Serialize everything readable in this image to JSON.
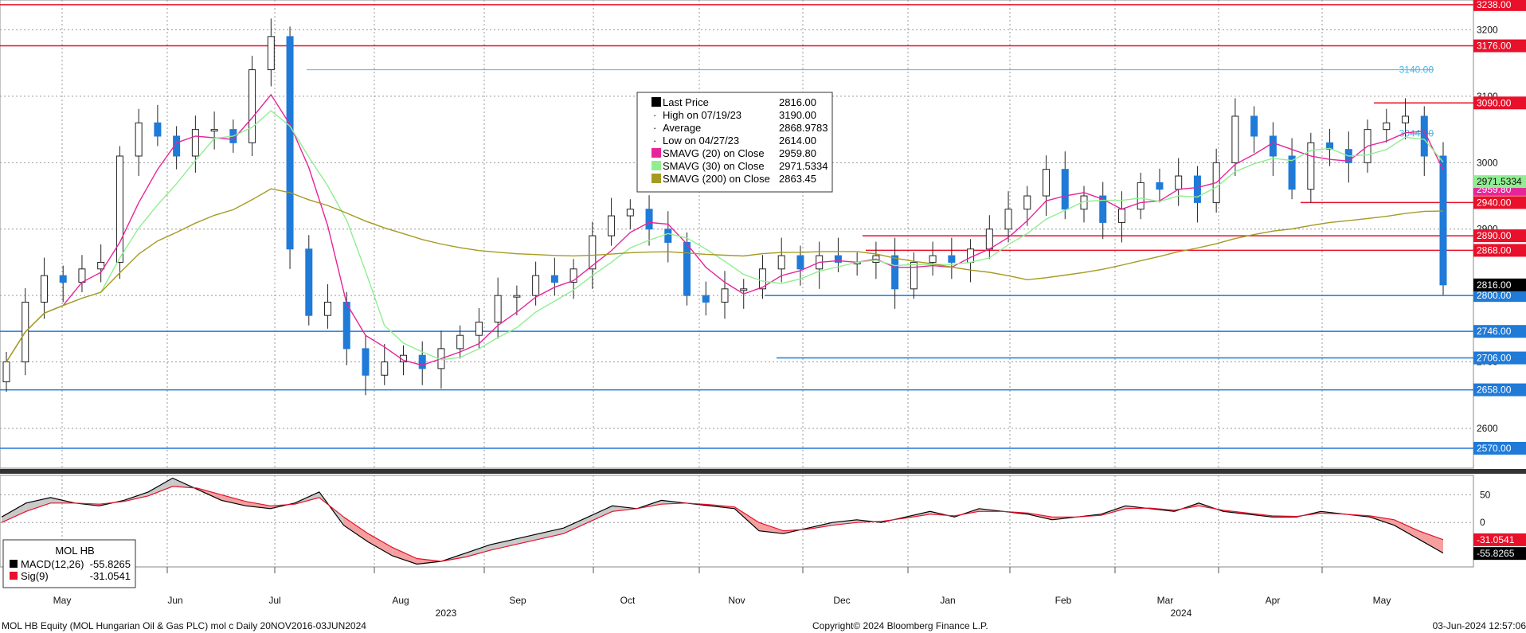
{
  "chart_data": [
    {
      "type": "candlestick",
      "title": "MOL HB Equity (MOL Hungarian Oil & Gas PLC) mol c  Daily 20NOV2016-03JUN2024",
      "x_months": [
        "May",
        "Jun",
        "Jul",
        "Aug",
        "Sep",
        "Oct",
        "Nov",
        "Dec",
        "Jan",
        "Feb",
        "Mar",
        "Apr",
        "May"
      ],
      "x_years": [
        "2023",
        "2024"
      ],
      "ylim": [
        2540,
        3245
      ],
      "y_ticks": [
        2600,
        2700,
        2800,
        2900,
        3000,
        3100,
        3200
      ],
      "grid": true,
      "candles_weekly_close": [
        2700,
        2790,
        2830,
        2820,
        2840,
        2850,
        3010,
        3060,
        3040,
        3010,
        3050,
        3050,
        3030,
        3140,
        3190,
        2870,
        2770,
        2790,
        2720,
        2680,
        2700,
        2710,
        2690,
        2720,
        2740,
        2760,
        2800,
        2800,
        2830,
        2820,
        2840,
        2890,
        2920,
        2930,
        2900,
        2880,
        2800,
        2790,
        2810,
        2810,
        2840,
        2860,
        2840,
        2860,
        2850,
        2850,
        2860,
        2810,
        2850,
        2860,
        2850,
        2870,
        2900,
        2930,
        2950,
        2990,
        2930,
        2950,
        2910,
        2930,
        2970,
        2960,
        2980,
        2940,
        3000,
        3070,
        3040,
        3010,
        2960,
        3030,
        3020,
        3000,
        3050,
        3060,
        3070,
        3010,
        2816
      ],
      "series": [
        {
          "name": "SMAVG (20)  on Close",
          "last": 2959.8,
          "color": "#e8249a"
        },
        {
          "name": "SMAVG (30)  on Close",
          "last": 2971.5334,
          "color": "#90ee90"
        },
        {
          "name": "SMAVG (200)  on Close",
          "last": 2863.45,
          "color": "#a59a22"
        }
      ],
      "legend": {
        "placement": "top-center",
        "rows": [
          {
            "label": "Last Price",
            "value": "2816.00",
            "swatch": "#000000"
          },
          {
            "label": "High on 07/19/23",
            "value": "3190.00",
            "swatch": ""
          },
          {
            "label": "Average",
            "value": "2868.9783",
            "swatch": ""
          },
          {
            "label": "Low on 04/27/23",
            "value": "2614.00",
            "swatch": ""
          },
          {
            "label": "SMAVG (20)  on Close",
            "value": "2959.80",
            "swatch": "#e8249a"
          },
          {
            "label": "SMAVG (30)  on Close",
            "value": "2971.5334",
            "swatch": "#90ee90"
          },
          {
            "label": "SMAVG (200)  on Close",
            "value": "2863.45",
            "swatch": "#a59a22"
          }
        ]
      },
      "levels": [
        {
          "label": "3238.00",
          "value": 3238,
          "color": "#e8102a"
        },
        {
          "label": "3176.00",
          "value": 3176,
          "color": "#e8102a"
        },
        {
          "label": "3090.00",
          "value": 3090,
          "color": "#e8102a"
        },
        {
          "label": "2940.00",
          "value": 2940,
          "color": "#e8102a"
        },
        {
          "label": "2890.00",
          "value": 2890,
          "color": "#e8102a"
        },
        {
          "label": "2868.00",
          "value": 2868,
          "color": "#e8102a"
        },
        {
          "label": "2800.00",
          "value": 2800,
          "color": "#1f7ad8"
        },
        {
          "label": "2746.00",
          "value": 2746,
          "color": "#1f7ad8"
        },
        {
          "label": "2706.00",
          "value": 2706,
          "color": "#1f7ad8"
        },
        {
          "label": "2658.00",
          "value": 2658,
          "color": "#1f7ad8"
        },
        {
          "label": "2570.00",
          "value": 2570,
          "color": "#1f7ad8"
        }
      ],
      "axis_badges": [
        {
          "label": "2816.00",
          "value": 2816,
          "color": "#000000"
        },
        {
          "label": "2959.80",
          "value": 2959.8,
          "color": "#e8249a"
        },
        {
          "label": "2971.5334",
          "value": 2971.5334,
          "color": "#90ee90"
        }
      ],
      "fib_labels": [
        {
          "label": "3140.00",
          "value": 3140
        },
        {
          "label": "3044.00",
          "value": 3044
        }
      ]
    },
    {
      "type": "line",
      "title": "MOL HB",
      "ylim": [
        -80,
        85
      ],
      "y_ticks": [
        0,
        50
      ],
      "series": [
        {
          "name": "MACD(12,26)",
          "last": -55.8265,
          "color": "#000000",
          "values": [
            10,
            35,
            45,
            35,
            30,
            40,
            55,
            80,
            60,
            40,
            30,
            25,
            35,
            55,
            -5,
            -35,
            -60,
            -75,
            -70,
            -55,
            -40,
            -30,
            -20,
            -10,
            10,
            30,
            25,
            40,
            35,
            30,
            25,
            -15,
            -20,
            -10,
            0,
            5,
            0,
            10,
            20,
            10,
            25,
            20,
            15,
            5,
            10,
            15,
            30,
            25,
            20,
            35,
            20,
            15,
            10,
            10,
            20,
            15,
            10,
            -5,
            -30,
            -55
          ]
        },
        {
          "name": "Sig(9)",
          "last": -31.0541,
          "color": "#e8102a",
          "values": [
            0,
            20,
            35,
            35,
            33,
            38,
            48,
            65,
            62,
            50,
            38,
            30,
            33,
            45,
            10,
            -20,
            -45,
            -65,
            -70,
            -62,
            -50,
            -40,
            -30,
            -20,
            0,
            20,
            25,
            33,
            35,
            32,
            28,
            0,
            -15,
            -12,
            -5,
            0,
            2,
            8,
            15,
            12,
            20,
            20,
            17,
            10,
            10,
            13,
            25,
            26,
            22,
            30,
            22,
            17,
            12,
            11,
            17,
            15,
            12,
            5,
            -15,
            -31
          ]
        }
      ],
      "legend": {
        "placement": "bottom-left",
        "rows": [
          {
            "label": "MACD(12,26)",
            "value": "-55.8265",
            "swatch": "#000000"
          },
          {
            "label": "Sig(9)",
            "value": "-31.0541",
            "swatch": "#e8102a"
          }
        ]
      },
      "axis_badges": [
        {
          "label": "-31.0541",
          "value": -31.0541,
          "color": "#e8102a"
        },
        {
          "label": "-55.8265",
          "value": -55.8265,
          "color": "#000000"
        }
      ]
    }
  ],
  "footer": {
    "left": "MOL HB Equity (MOL Hungarian Oil & Gas PLC) mol c  Daily 20NOV2016-03JUN2024",
    "center": "Copyright© 2024 Bloomberg Finance L.P.",
    "right": "03-Jun-2024 12:57:06"
  }
}
